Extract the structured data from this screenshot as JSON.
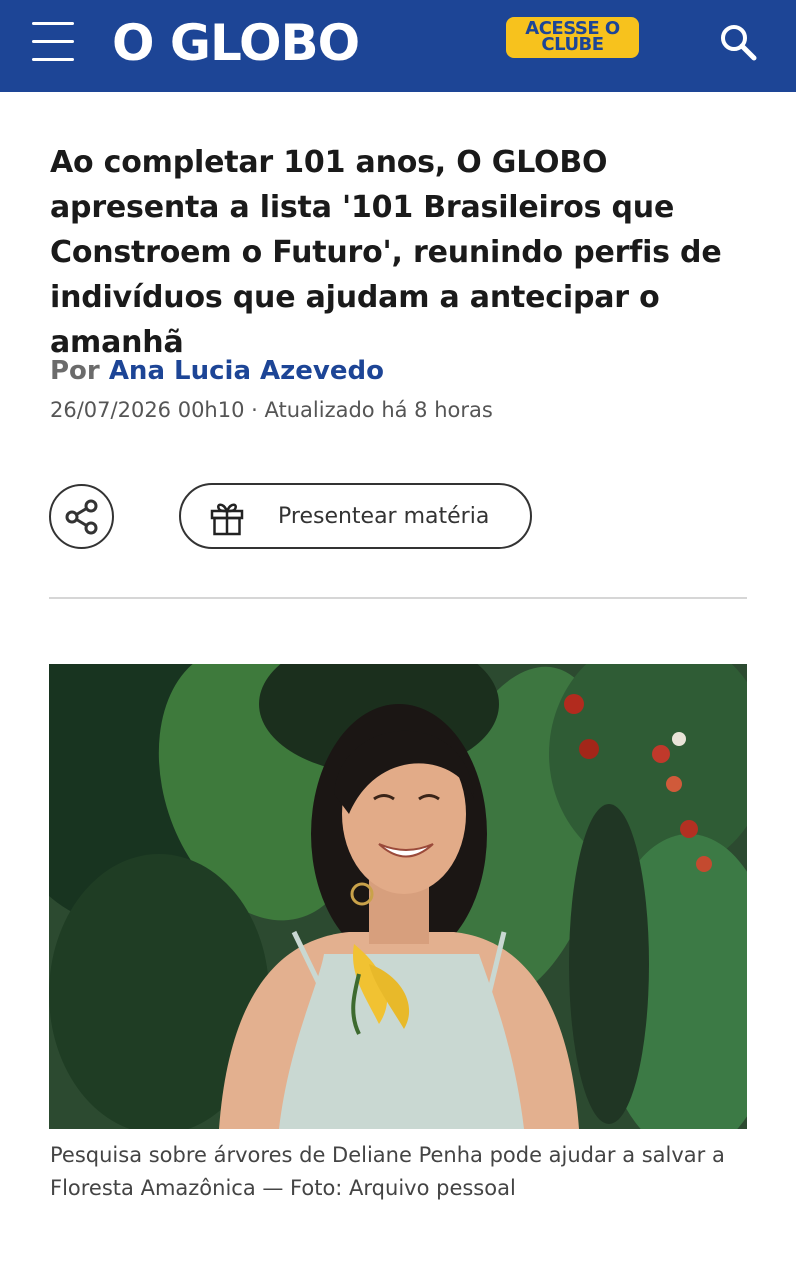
{
  "header": {
    "logo": "O GLOBO",
    "club_button": [
      "ACESSE O",
      "CLUBE"
    ],
    "brand_color": "#1d4596",
    "accent_color": "#f7c21d",
    "icons": [
      "menu-icon",
      "search-icon"
    ]
  },
  "article": {
    "headline": "Ao completar 101 anos, O GLOBO apresenta a lista '101 Brasileiros que Constroem o Futuro', reunindo perfis de indivíduos que ajudam a antecipar o amanhã",
    "byline_prefix": "Por",
    "author": "Ana Lucia Azevedo",
    "dateline": "26/07/2026 00h10 · Atualizado há 8 horas",
    "actions": {
      "share_icon": "share-icon",
      "gift_icon": "gift-icon",
      "gift_label": "Presentear matéria"
    },
    "photo_caption": "Pesquisa sobre árvores de Deliane Penha pode ajudar a salvar a Floresta Amazônica — Foto: Arquivo pessoal"
  }
}
